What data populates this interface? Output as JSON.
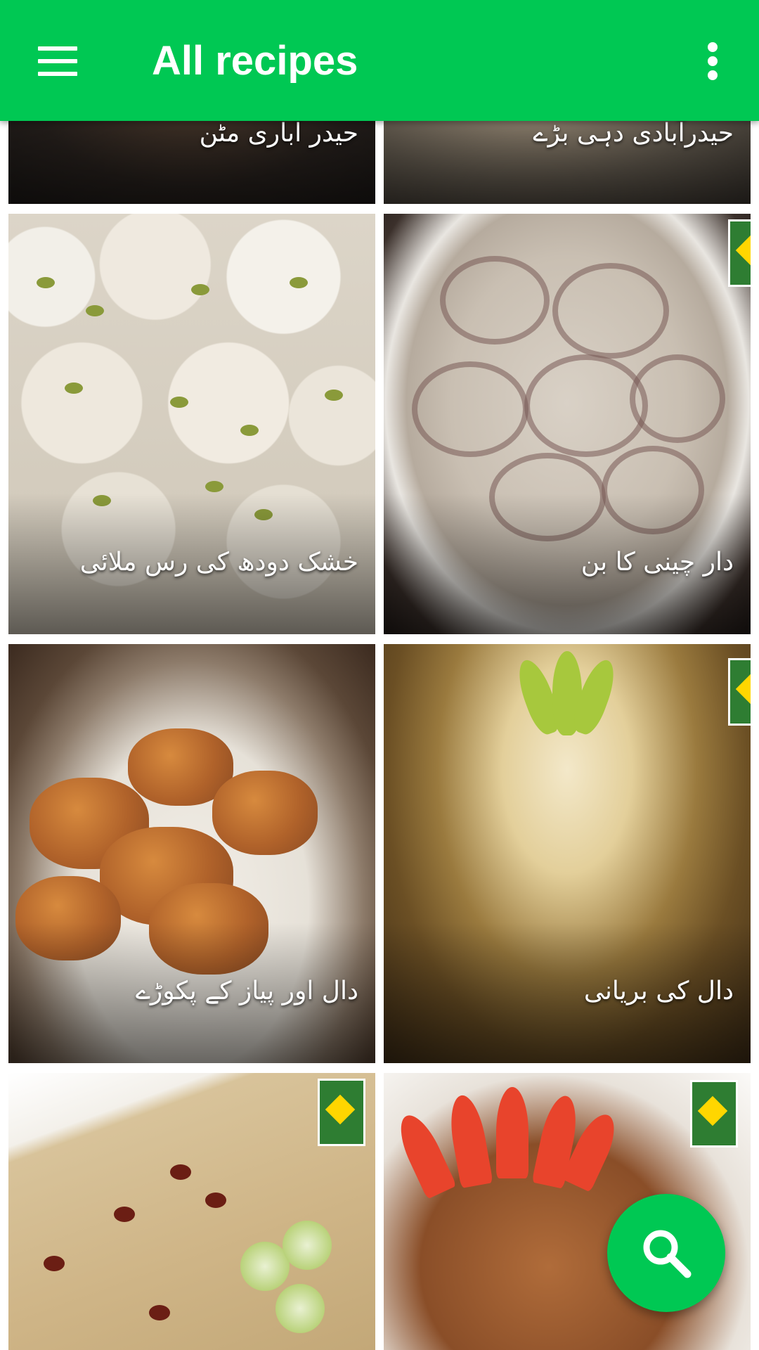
{
  "app_bar": {
    "menu_icon": "hamburger-menu-icon",
    "title": "All recipes",
    "overflow_icon": "more-vertical-icon",
    "background_color": "#00c853"
  },
  "recipes": [
    {
      "label": "حیدر آباری مٹن"
    },
    {
      "label": "حیدرآبادی دہی بڑے"
    },
    {
      "label": "خشک دودھ کی رس ملائی"
    },
    {
      "label": "دار چینی کا بن"
    },
    {
      "label": "دال اور پیاز کے پکوڑے"
    },
    {
      "label": "دال کی بریانی"
    },
    {
      "label": ""
    },
    {
      "label": ""
    }
  ],
  "fab": {
    "icon": "search-icon",
    "color": "#00c853"
  }
}
